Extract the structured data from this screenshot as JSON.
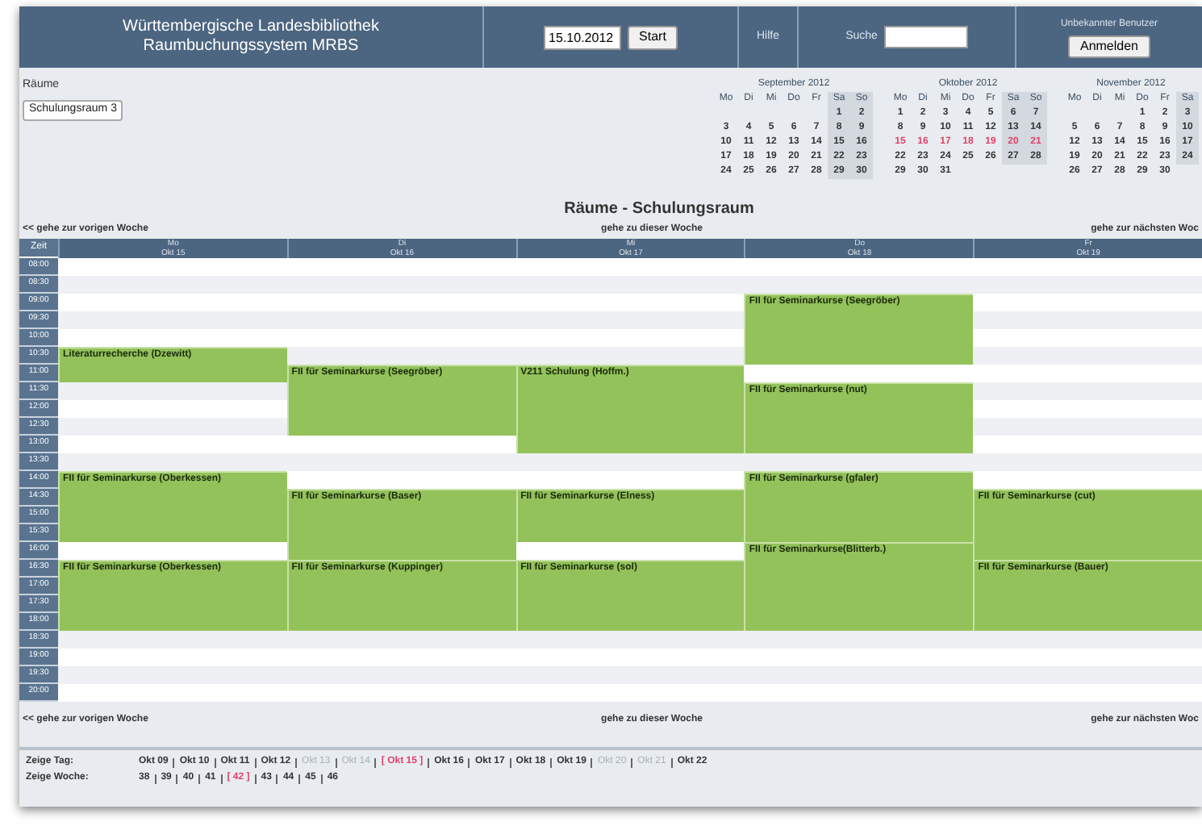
{
  "header": {
    "title_lines": [
      "Württembergische Landesbibliothek",
      "Raumbuchungssystem MRBS"
    ],
    "date_field": {
      "value": "15.10.2012"
    },
    "start_button": "Start",
    "help_link": "Hilfe",
    "search": {
      "label": "Suche"
    },
    "user": {
      "label": "Unbekannter Benutzer",
      "login_button": "Anmelden"
    }
  },
  "rooms": {
    "label": "Räume",
    "select": {
      "value": "Schulungsraum 3"
    }
  },
  "mini_calendars": [
    {
      "title": "September 2012",
      "weekdays": [
        "Mo",
        "Di",
        "Mi",
        "Do",
        "Fr",
        "Sa",
        "So"
      ],
      "weeks": [
        {
          "days": [
            "1",
            "2"
          ],
          "right_aligned": true,
          "selected": false
        },
        {
          "days": [
            "3",
            "4",
            "5",
            "6",
            "7",
            "8",
            "9"
          ],
          "selected": false
        },
        {
          "days": [
            "10",
            "11",
            "12",
            "13",
            "14",
            "15",
            "16"
          ],
          "selected": false
        },
        {
          "days": [
            "17",
            "18",
            "19",
            "20",
            "21",
            "22",
            "23"
          ],
          "selected": false
        },
        {
          "days": [
            "24",
            "25",
            "26",
            "27",
            "28",
            "29",
            "30"
          ],
          "selected": false
        }
      ]
    },
    {
      "title": "Oktober 2012",
      "weekdays": [
        "Mo",
        "Di",
        "Mi",
        "Do",
        "Fr",
        "Sa",
        "So"
      ],
      "weeks": [
        {
          "days": [
            "1",
            "2",
            "3",
            "4",
            "5",
            "6",
            "7"
          ],
          "selected": false
        },
        {
          "days": [
            "8",
            "9",
            "10",
            "11",
            "12",
            "13",
            "14"
          ],
          "selected": false
        },
        {
          "days": [
            "15",
            "16",
            "17",
            "18",
            "19",
            "20",
            "21"
          ],
          "selected": true
        },
        {
          "days": [
            "22",
            "23",
            "24",
            "25",
            "26",
            "27",
            "28"
          ],
          "selected": false
        },
        {
          "days": [
            "29",
            "30",
            "31"
          ],
          "right_aligned": false,
          "selected": false
        }
      ]
    },
    {
      "title": "November 2012",
      "weekdays": [
        "Mo",
        "Di",
        "Mi",
        "Do",
        "Fr",
        "Sa"
      ],
      "weeks": [
        {
          "days": [
            "1",
            "2",
            "3"
          ],
          "right_aligned": true,
          "selected": false
        },
        {
          "days": [
            "5",
            "6",
            "7",
            "8",
            "9",
            "10"
          ],
          "selected": false
        },
        {
          "days": [
            "12",
            "13",
            "14",
            "15",
            "16",
            "17"
          ],
          "selected": false
        },
        {
          "days": [
            "19",
            "20",
            "21",
            "22",
            "23",
            "24"
          ],
          "selected": false
        },
        {
          "days": [
            "26",
            "27",
            "28",
            "29",
            "30"
          ],
          "right_aligned": false,
          "selected": false
        }
      ]
    }
  ],
  "page_title": "Räume - Schulungsraum",
  "nav_top": {
    "prev": "<< gehe zur vorigen Woche",
    "current": "gehe zu dieser Woche",
    "next": "gehe zur nächsten Woc"
  },
  "schedule": {
    "time_header": "Zeit",
    "days": [
      {
        "weekday": "Mo",
        "date": "Okt 15"
      },
      {
        "weekday": "Di",
        "date": "Okt 16"
      },
      {
        "weekday": "Mi",
        "date": "Okt 17"
      },
      {
        "weekday": "Do",
        "date": "Okt 18"
      },
      {
        "weekday": "Fr",
        "date": "Okt 19"
      }
    ],
    "rows": [
      {
        "time": "08:00",
        "cells": [
          {
            "kind": "free"
          },
          {
            "kind": "free"
          },
          {
            "kind": "free"
          },
          {
            "kind": "free"
          },
          {
            "kind": "free"
          }
        ]
      },
      {
        "time": "08:30",
        "cells": [
          {
            "kind": "free"
          },
          {
            "kind": "free"
          },
          {
            "kind": "free"
          },
          {
            "kind": "free"
          },
          {
            "kind": "free"
          }
        ]
      },
      {
        "time": "09:00",
        "cells": [
          {
            "kind": "free"
          },
          {
            "kind": "free"
          },
          {
            "kind": "free"
          },
          {
            "kind": "booking",
            "title": "FII für Seminarkurse (Seegröber)"
          },
          {
            "kind": "free"
          }
        ]
      },
      {
        "time": "09:30",
        "cells": [
          {
            "kind": "free"
          },
          {
            "kind": "free"
          },
          {
            "kind": "free"
          },
          {
            "kind": "cont"
          },
          {
            "kind": "free"
          }
        ]
      },
      {
        "time": "10:00",
        "cells": [
          {
            "kind": "free"
          },
          {
            "kind": "free"
          },
          {
            "kind": "free"
          },
          {
            "kind": "cont"
          },
          {
            "kind": "free"
          }
        ]
      },
      {
        "time": "10:30",
        "cells": [
          {
            "kind": "booking",
            "title": "Literaturrecherche (Dzewitt)"
          },
          {
            "kind": "free"
          },
          {
            "kind": "free"
          },
          {
            "kind": "cont"
          },
          {
            "kind": "free"
          }
        ]
      },
      {
        "time": "11:00",
        "cells": [
          {
            "kind": "cont"
          },
          {
            "kind": "booking",
            "title": "FII für Seminarkurse (Seegröber)"
          },
          {
            "kind": "booking",
            "title": "V211 Schulung (Hoffm.)"
          },
          {
            "kind": "free"
          },
          {
            "kind": "free"
          }
        ]
      },
      {
        "time": "11:30",
        "cells": [
          {
            "kind": "free"
          },
          {
            "kind": "cont"
          },
          {
            "kind": "cont"
          },
          {
            "kind": "booking",
            "title": "FII für Seminarkurse (nut)"
          },
          {
            "kind": "free"
          }
        ]
      },
      {
        "time": "12:00",
        "cells": [
          {
            "kind": "free"
          },
          {
            "kind": "cont"
          },
          {
            "kind": "cont"
          },
          {
            "kind": "cont"
          },
          {
            "kind": "free"
          }
        ]
      },
      {
        "time": "12:30",
        "cells": [
          {
            "kind": "free"
          },
          {
            "kind": "cont"
          },
          {
            "kind": "cont"
          },
          {
            "kind": "cont"
          },
          {
            "kind": "free"
          }
        ]
      },
      {
        "time": "13:00",
        "cells": [
          {
            "kind": "free"
          },
          {
            "kind": "free"
          },
          {
            "kind": "cont"
          },
          {
            "kind": "cont"
          },
          {
            "kind": "free"
          }
        ]
      },
      {
        "time": "13:30",
        "cells": [
          {
            "kind": "free"
          },
          {
            "kind": "free"
          },
          {
            "kind": "free"
          },
          {
            "kind": "free"
          },
          {
            "kind": "free"
          }
        ]
      },
      {
        "time": "14:00",
        "cells": [
          {
            "kind": "booking",
            "title": "FII für Seminarkurse (Oberkessen)"
          },
          {
            "kind": "free"
          },
          {
            "kind": "free"
          },
          {
            "kind": "booking",
            "title": "FII für Seminarkurse (gfaler)"
          },
          {
            "kind": "free"
          }
        ]
      },
      {
        "time": "14:30",
        "cells": [
          {
            "kind": "cont"
          },
          {
            "kind": "booking",
            "title": "FII für Seminarkurse (Baser)"
          },
          {
            "kind": "booking",
            "title": "FII für Seminarkurse (Elness)"
          },
          {
            "kind": "cont"
          },
          {
            "kind": "booking",
            "title": "FII für Seminarkurse (cut)"
          }
        ]
      },
      {
        "time": "15:00",
        "cells": [
          {
            "kind": "cont"
          },
          {
            "kind": "cont"
          },
          {
            "kind": "cont"
          },
          {
            "kind": "cont"
          },
          {
            "kind": "cont"
          }
        ]
      },
      {
        "time": "15:30",
        "cells": [
          {
            "kind": "cont"
          },
          {
            "kind": "cont"
          },
          {
            "kind": "cont"
          },
          {
            "kind": "cont"
          },
          {
            "kind": "cont"
          }
        ]
      },
      {
        "time": "16:00",
        "cells": [
          {
            "kind": "free"
          },
          {
            "kind": "cont"
          },
          {
            "kind": "free"
          },
          {
            "kind": "booking",
            "title": "FII für Seminarkurse(Blitterb.)"
          },
          {
            "kind": "cont"
          }
        ]
      },
      {
        "time": "16:30",
        "cells": [
          {
            "kind": "booking",
            "title": "FII für Seminarkurse (Oberkessen)"
          },
          {
            "kind": "booking",
            "title": "FII für Seminarkurse (Kuppinger)"
          },
          {
            "kind": "booking",
            "title": "FII für Seminarkurse (sol)"
          },
          {
            "kind": "cont"
          },
          {
            "kind": "booking",
            "title": "FII für Seminarkurse (Bauer)"
          }
        ]
      },
      {
        "time": "17:00",
        "cells": [
          {
            "kind": "cont"
          },
          {
            "kind": "cont"
          },
          {
            "kind": "cont"
          },
          {
            "kind": "cont"
          },
          {
            "kind": "cont"
          }
        ]
      },
      {
        "time": "17:30",
        "cells": [
          {
            "kind": "cont"
          },
          {
            "kind": "cont"
          },
          {
            "kind": "cont"
          },
          {
            "kind": "cont"
          },
          {
            "kind": "cont"
          }
        ]
      },
      {
        "time": "18:00",
        "cells": [
          {
            "kind": "cont"
          },
          {
            "kind": "cont"
          },
          {
            "kind": "cont"
          },
          {
            "kind": "cont"
          },
          {
            "kind": "cont"
          }
        ]
      },
      {
        "time": "18:30",
        "cells": [
          {
            "kind": "free"
          },
          {
            "kind": "free"
          },
          {
            "kind": "free"
          },
          {
            "kind": "free"
          },
          {
            "kind": "free"
          }
        ]
      },
      {
        "time": "19:00",
        "cells": [
          {
            "kind": "free"
          },
          {
            "kind": "free"
          },
          {
            "kind": "free"
          },
          {
            "kind": "free"
          },
          {
            "kind": "free"
          }
        ]
      },
      {
        "time": "19:30",
        "cells": [
          {
            "kind": "free"
          },
          {
            "kind": "free"
          },
          {
            "kind": "free"
          },
          {
            "kind": "free"
          },
          {
            "kind": "free"
          }
        ]
      },
      {
        "time": "20:00",
        "cells": [
          {
            "kind": "free"
          },
          {
            "kind": "free"
          },
          {
            "kind": "free"
          },
          {
            "kind": "free"
          },
          {
            "kind": "free"
          }
        ]
      }
    ]
  },
  "nav_bottom": {
    "prev": "<< gehe zur vorigen Woche",
    "current": "gehe zu dieser Woche",
    "next": "gehe zur nächsten Woc"
  },
  "footer": {
    "day_label": "Zeige Tag:",
    "days": [
      {
        "text": "Okt 09",
        "selected": false,
        "disabled": false
      },
      {
        "text": "Okt 10",
        "selected": false,
        "disabled": false
      },
      {
        "text": "Okt 11",
        "selected": false,
        "disabled": false
      },
      {
        "text": "Okt 12",
        "selected": false,
        "disabled": false
      },
      {
        "text": "Okt 13",
        "selected": false,
        "disabled": true
      },
      {
        "text": "Okt 14",
        "selected": false,
        "disabled": true
      },
      {
        "text": "[ Okt 15 ]",
        "selected": true,
        "disabled": false
      },
      {
        "text": "Okt 16",
        "selected": false,
        "disabled": false
      },
      {
        "text": "Okt 17",
        "selected": false,
        "disabled": false
      },
      {
        "text": "Okt 18",
        "selected": false,
        "disabled": false
      },
      {
        "text": "Okt 19",
        "selected": false,
        "disabled": false
      },
      {
        "text": "Okt 20",
        "selected": false,
        "disabled": true
      },
      {
        "text": "Okt 21",
        "selected": false,
        "disabled": true
      },
      {
        "text": "Okt 22",
        "selected": false,
        "disabled": false
      }
    ],
    "week_label": "Zeige Woche:",
    "weeks": [
      {
        "text": "38",
        "selected": false
      },
      {
        "text": "39",
        "selected": false
      },
      {
        "text": "40",
        "selected": false
      },
      {
        "text": "41",
        "selected": false
      },
      {
        "text": "[ 42 ]",
        "selected": true
      },
      {
        "text": "43",
        "selected": false
      },
      {
        "text": "44",
        "selected": false
      },
      {
        "text": "45",
        "selected": false
      },
      {
        "text": "46",
        "selected": false
      }
    ]
  }
}
